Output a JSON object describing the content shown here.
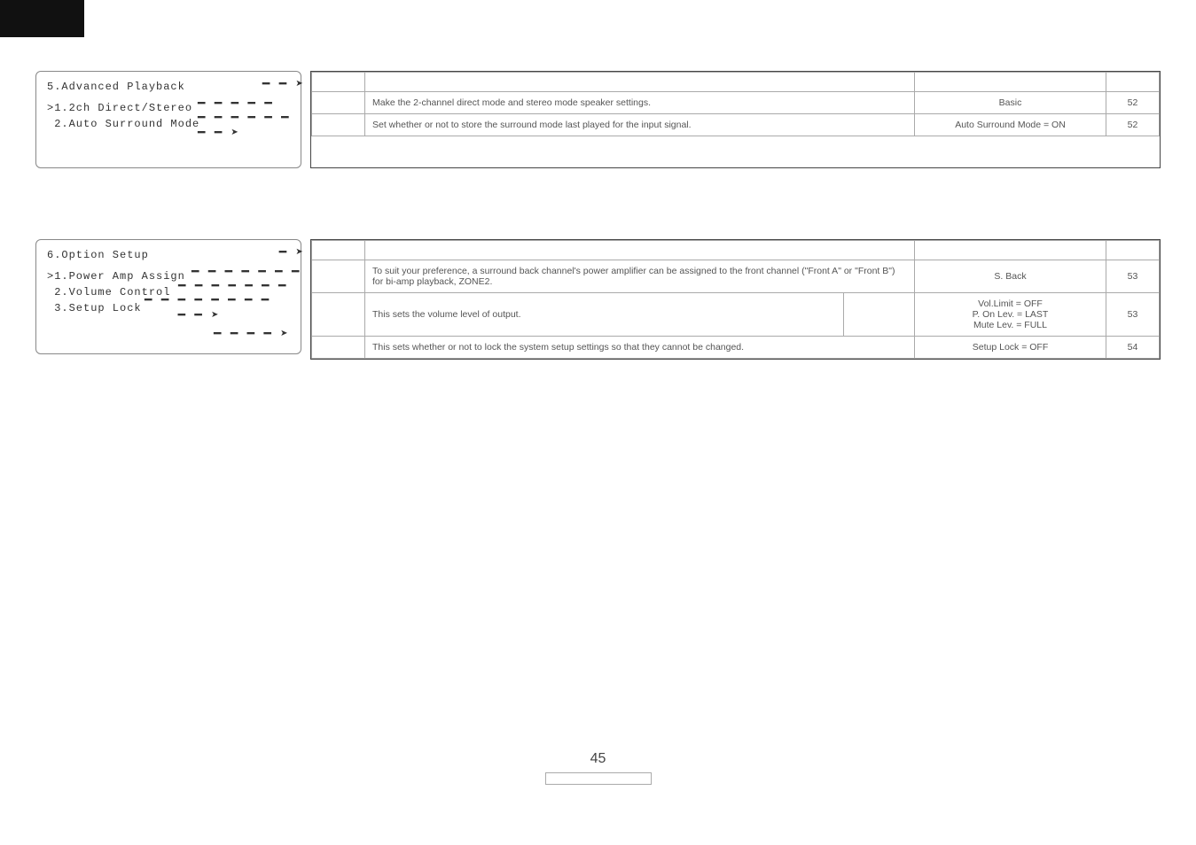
{
  "black_tab": "",
  "menus": {
    "m1": {
      "title": "5.Advanced Playback",
      "line1": ">1.2ch Direct/Stereo",
      "line2": " 2.Auto Surround Mode"
    },
    "m2": {
      "title": "6.Option Setup",
      "line1": ">1.Power Amp Assign",
      "line2": " 2.Volume Control",
      "line3": " 3.Setup Lock"
    }
  },
  "tables": {
    "t1": {
      "r1": {
        "desc": "Make the 2-channel direct mode and stereo mode speaker settings.",
        "default": "Basic",
        "page": "52"
      },
      "r2": {
        "desc": "Set whether or not to store the surround mode last played for the input signal.",
        "default": "Auto Surround Mode = ON",
        "page": "52"
      }
    },
    "t2": {
      "r1": {
        "desc": "To suit your preference, a surround back channel's power amplifier can be assigned to the front channel (\"Front A\" or \"Front B\") for bi-amp playback, ZONE2.",
        "default": "S. Back",
        "page": "53"
      },
      "r2": {
        "desc": "This sets the volume level of output.",
        "default": "Vol.Limit = OFF\nP. On Lev. = LAST\nMute Lev. = FULL",
        "page": "53"
      },
      "r3": {
        "desc": "This sets whether or not to lock the system setup settings so that they cannot be changed.",
        "default": "Setup Lock = OFF",
        "page": "54"
      }
    }
  },
  "page_number": "45"
}
